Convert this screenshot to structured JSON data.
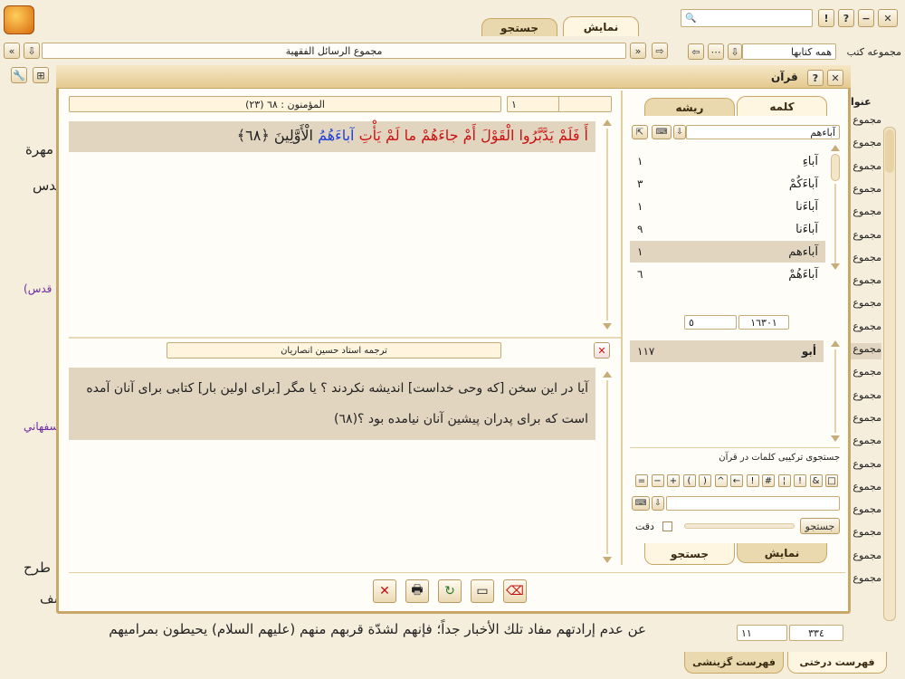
{
  "top": {
    "tab_view": "نمایش",
    "tab_search": "جستجو",
    "book_title": "مجموع الرسائل الفقهية",
    "collection_label": "مجموعه كتب",
    "collection_value": "همه كتابها",
    "search_placeholder": ""
  },
  "background": {
    "snippets": [
      "مهرة",
      "قدس",
      "(قدس",
      "سفهاني",
      "طرح",
      "شف"
    ],
    "bottom_line": "عن عدم إرادتهم مفاد تلك الأخبار جداً؛ فإنهم لشدّة قربهم منهم (عليهم السلام) يحيطون بمراميهم",
    "title_col": "عنوا",
    "side_item": "مجموع",
    "side_count": 21
  },
  "bottom_right": {
    "num_left": "١١",
    "num_right": "٣٣٤",
    "tab_tree": "فهرست درختی",
    "tab_selective": "فهرست گزینشی"
  },
  "dialog": {
    "title": "قرآن",
    "verse_bar": {
      "box1": "١",
      "box2": "١",
      "sura_label": "(٢٣) المؤمنون : ٦٨"
    },
    "verse_text_black": "أَ فَلَمْ يَدَّبَّرُوا الْقَوْلَ أَمْ جاءَهُمْ ما لَمْ يَأْتِ ",
    "verse_text_blue": "آباءَهُمُ",
    "verse_text_end": " الْأَوَّلِينَ ﴿٦٨﴾",
    "translation_title": "ترجمه استاد حسین انصاریان",
    "translation_text": "آیا در این سخن [که وحی خداست] اندیشه نکردند ؟ یا مگر [برای اولین بار] کتابی برای آنان آمده است که برای پدران پیشین آنان نیامده بود ؟(٦٨)",
    "tabs": {
      "word": "كلمه",
      "root": "ریشه"
    },
    "word_input": "آباءهم",
    "words": [
      {
        "word": "آباءِ",
        "count": "١"
      },
      {
        "word": "آباءَكُمْ",
        "count": "٣"
      },
      {
        "word": "آباءَنا",
        "count": "١"
      },
      {
        "word": "آباءَنا",
        "count": "٩"
      },
      {
        "word": "آباءهم",
        "count": "١",
        "selected": true
      },
      {
        "word": "آباءَهُمْ",
        "count": "٦"
      }
    ],
    "paging": {
      "left": "٥",
      "right": "١٦٣٠١"
    },
    "root_row": {
      "word": "أبو",
      "count": "١١٧"
    },
    "combo_title": "جستجوی تركیبی كلمات در قرآن",
    "symbols": [
      "□",
      "&",
      "!",
      "¦",
      "#",
      "!",
      "←",
      "^",
      ")",
      "(",
      "+",
      "−",
      "="
    ],
    "search_btn": "جستجو",
    "precision_label": "دقت",
    "bottom_tabs": {
      "view": "نمایش",
      "search": "جستجو"
    }
  },
  "colors": {
    "accent_blue": "#1d3fd8",
    "verse_red": "#cc1111",
    "highlight": "#e2d5c0",
    "frame": "#c9a766"
  }
}
